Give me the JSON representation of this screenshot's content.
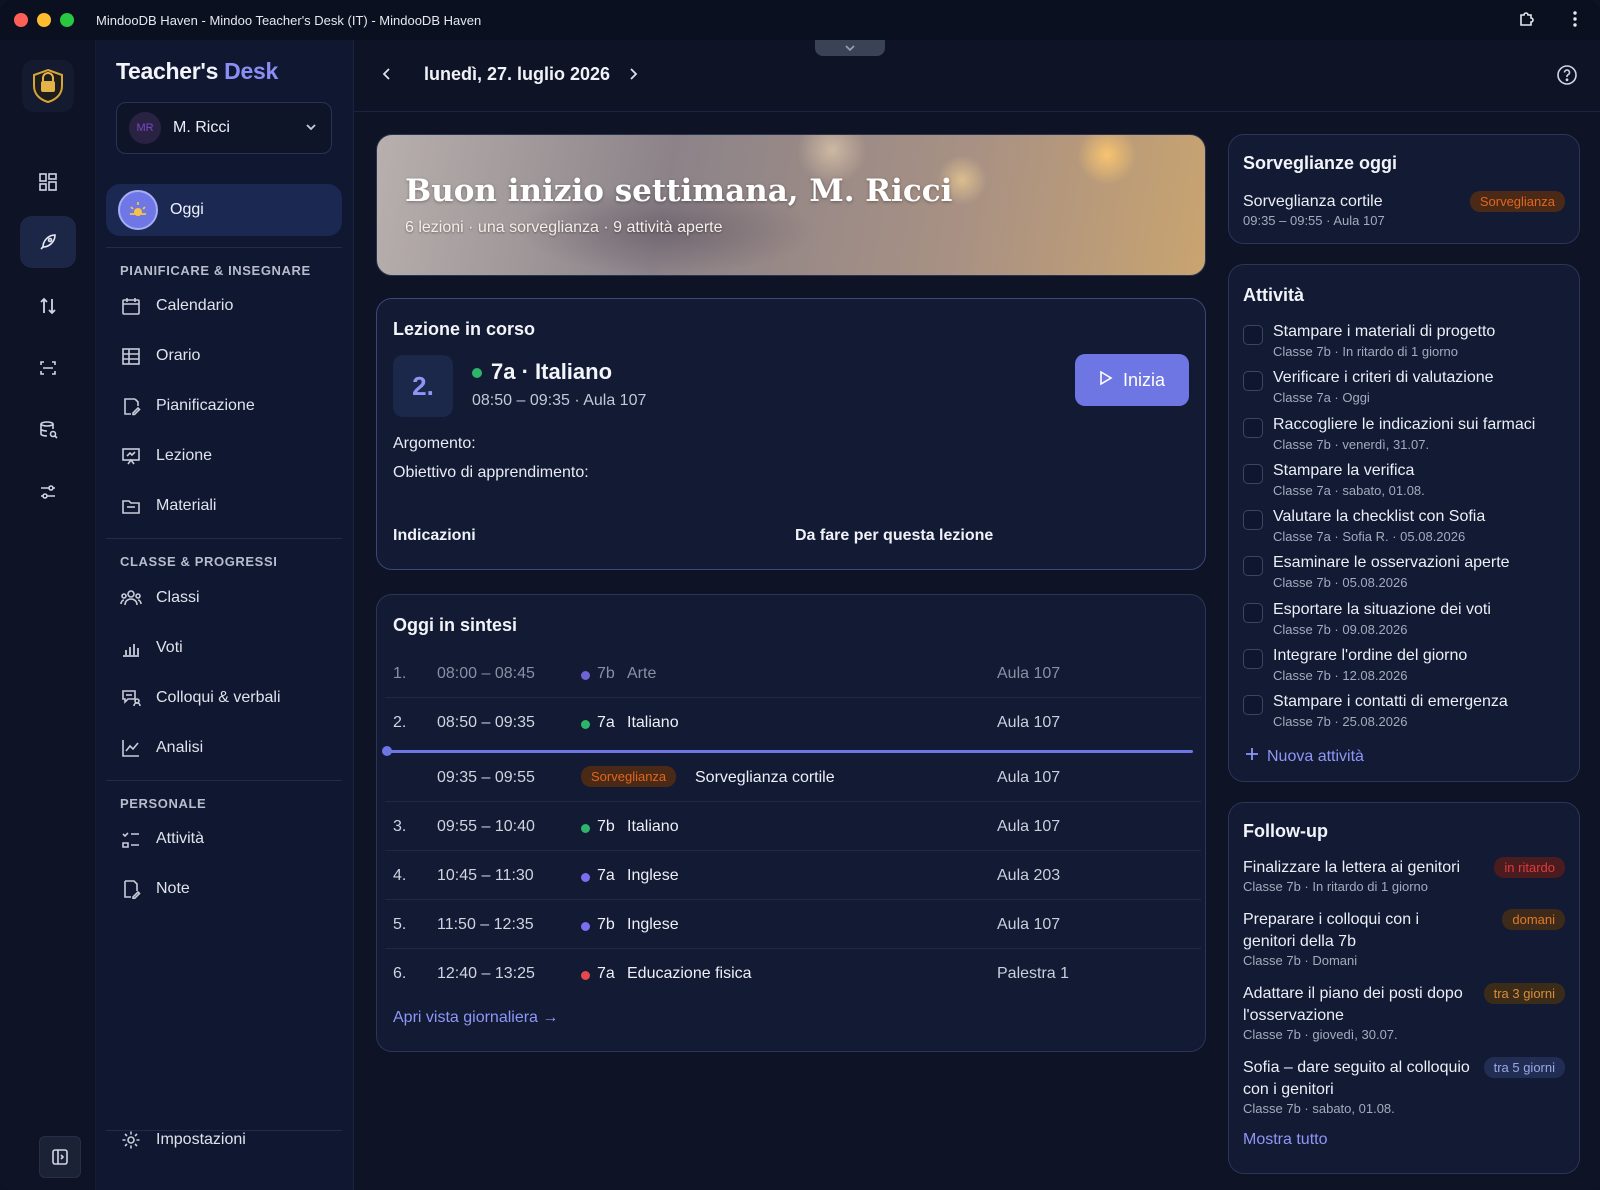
{
  "window": {
    "title": "MindooDB Haven - Mindoo Teacher's Desk (IT) - MindooDB Haven"
  },
  "brand": {
    "part1": "Teacher's",
    "part2": "Desk"
  },
  "user": {
    "initials": "MR",
    "name": "M. Ricci"
  },
  "nav": {
    "today": "Oggi",
    "section1": "PIANIFICARE & INSEGNARE",
    "section2": "CLASSE & PROGRESSI",
    "section3": "PERSONALE",
    "items1": [
      "Calendario",
      "Orario",
      "Pianificazione",
      "Lezione",
      "Materiali"
    ],
    "items2": [
      "Classi",
      "Voti",
      "Colloqui & verbali",
      "Analisi"
    ],
    "items3": [
      "Attività",
      "Note"
    ],
    "settings": "Impostazioni"
  },
  "header": {
    "date": "lunedì, 27. luglio 2026"
  },
  "hero": {
    "title": "Buon inizio settimana, M. Ricci",
    "subtitle": "6 lezioni · una sorveglianza · 9 attività aperte"
  },
  "current_lesson": {
    "card_title": "Lezione in corso",
    "number": "2.",
    "title": "7a · Italiano",
    "time": "08:50 – 09:35 · Aula 107",
    "start_label": "Inizia",
    "topic_label": "Argomento:",
    "goal_label": "Obiettivo di apprendimento:",
    "notes_label": "Indicazioni",
    "todo_label": "Da fare per questa lezione"
  },
  "summary": {
    "card_title": "Oggi in sintesi",
    "rows": [
      {
        "num": "1.",
        "time": "08:00 – 08:45",
        "cls": "7b",
        "subject": "Arte",
        "room": "Aula 107",
        "dot": "#7b6ef0"
      },
      {
        "num": "2.",
        "time": "08:50 – 09:35",
        "cls": "7a",
        "subject": "Italiano",
        "room": "Aula 107",
        "dot": "#2db56a"
      },
      {
        "num": "",
        "time": "09:35 – 09:55",
        "badge": "Sorveglianza",
        "subject": "Sorveglianza cortile",
        "room": "Aula 107"
      },
      {
        "num": "3.",
        "time": "09:55 – 10:40",
        "cls": "7b",
        "subject": "Italiano",
        "room": "Aula 107",
        "dot": "#2db56a"
      },
      {
        "num": "4.",
        "time": "10:45 – 11:30",
        "cls": "7a",
        "subject": "Inglese",
        "room": "Aula 203",
        "dot": "#7b6ef0"
      },
      {
        "num": "5.",
        "time": "11:50 – 12:35",
        "cls": "7b",
        "subject": "Inglese",
        "room": "Aula 107",
        "dot": "#7b6ef0"
      },
      {
        "num": "6.",
        "time": "12:40 – 13:25",
        "cls": "7a",
        "subject": "Educazione fisica",
        "room": "Palestra 1",
        "dot": "#e5484d"
      }
    ],
    "link": "Apri vista giornaliera →"
  },
  "supervision": {
    "card_title": "Sorveglianze oggi",
    "name": "Sorveglianza cortile",
    "meta": "09:35 – 09:55 · Aula 107",
    "badge": "Sorveglianza"
  },
  "tasks": {
    "card_title": "Attività",
    "items": [
      {
        "title": "Stampare i materiali di progetto",
        "meta": "Classe 7b · In ritardo di 1 giorno"
      },
      {
        "title": "Verificare i criteri di valutazione",
        "meta": "Classe 7a · Oggi"
      },
      {
        "title": "Raccogliere le indicazioni sui farmaci",
        "meta": "Classe 7b · venerdì, 31.07."
      },
      {
        "title": "Stampare la verifica",
        "meta": "Classe 7a · sabato, 01.08."
      },
      {
        "title": "Valutare la checklist con Sofia",
        "meta": "Classe 7a · Sofia R. · 05.08.2026"
      },
      {
        "title": "Esaminare le osservazioni aperte",
        "meta": "Classe 7b · 05.08.2026"
      },
      {
        "title": "Esportare la situazione dei voti",
        "meta": "Classe 7b · 09.08.2026"
      },
      {
        "title": "Integrare l'ordine del giorno",
        "meta": "Classe 7b · 12.08.2026"
      },
      {
        "title": "Stampare i contatti di emergenza",
        "meta": "Classe 7b · 25.08.2026"
      }
    ],
    "add": "Nuova attività"
  },
  "followup": {
    "card_title": "Follow-up",
    "items": [
      {
        "title": "Finalizzare la lettera ai genitori",
        "meta": "Classe 7b · In ritardo di 1 giorno",
        "badge": "in ritardo"
      },
      {
        "title": "Preparare i colloqui con i genitori della 7b",
        "meta": "Classe 7b · Domani",
        "badge": "domani"
      },
      {
        "title": "Adattare il piano dei posti dopo l'osservazione",
        "meta": "Classe 7b · giovedì, 30.07.",
        "badge": "tra 3 giorni"
      },
      {
        "title": "Sofia – dare seguito al colloquio con i genitori",
        "meta": "Classe 7b · sabato, 01.08.",
        "badge": "tra 5 giorni"
      }
    ],
    "show_all": "Mostra tutto"
  }
}
